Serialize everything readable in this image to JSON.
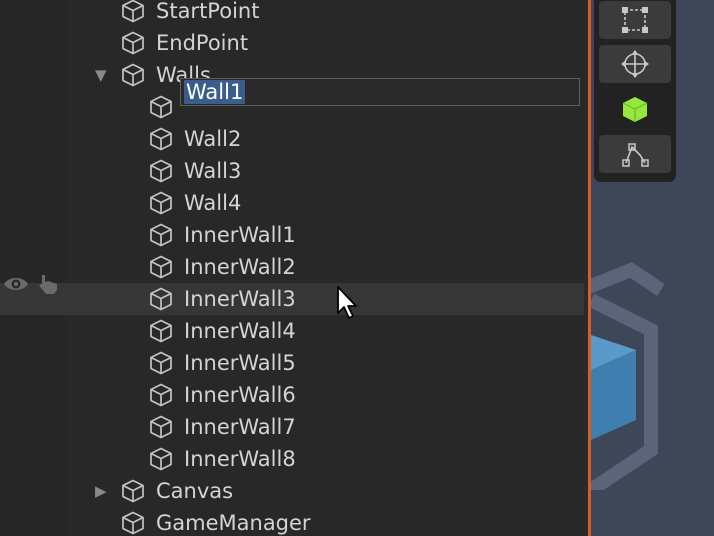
{
  "hierarchy": {
    "rows": [
      {
        "label": "StartPoint",
        "indent": 0,
        "arrow": ""
      },
      {
        "label": "EndPoint",
        "indent": 0,
        "arrow": ""
      },
      {
        "label": "Walls",
        "indent": 0,
        "arrow": "expanded"
      },
      {
        "label": "Wall1",
        "indent": 1,
        "arrow": "",
        "renaming": true
      },
      {
        "label": "Wall2",
        "indent": 1,
        "arrow": ""
      },
      {
        "label": "Wall3",
        "indent": 1,
        "arrow": ""
      },
      {
        "label": "Wall4",
        "indent": 1,
        "arrow": ""
      },
      {
        "label": "InnerWall1",
        "indent": 1,
        "arrow": ""
      },
      {
        "label": "InnerWall2",
        "indent": 1,
        "arrow": ""
      },
      {
        "label": "InnerWall3",
        "indent": 1,
        "arrow": "",
        "hovered": true
      },
      {
        "label": "InnerWall4",
        "indent": 1,
        "arrow": ""
      },
      {
        "label": "InnerWall5",
        "indent": 1,
        "arrow": ""
      },
      {
        "label": "InnerWall6",
        "indent": 1,
        "arrow": ""
      },
      {
        "label": "InnerWall7",
        "indent": 1,
        "arrow": ""
      },
      {
        "label": "InnerWall8",
        "indent": 1,
        "arrow": ""
      },
      {
        "label": "Canvas",
        "indent": 0,
        "arrow": "collapsed"
      },
      {
        "label": "GameManager",
        "indent": 0,
        "arrow": ""
      }
    ],
    "rename_value": "Wall1",
    "item_icon": "gameobject-cube-icon"
  },
  "gutter": {
    "visibility_icon": "eye-icon",
    "pickability_icon": "hand-pointer-icon"
  },
  "scene_toolbar": {
    "tools": [
      {
        "name": "rect-tool",
        "icon": "rect-transform-icon",
        "active": false
      },
      {
        "name": "transform-tool",
        "icon": "move-rotate-scale-icon",
        "active": false
      },
      {
        "name": "custom-tool",
        "icon": "green-cube-icon",
        "active": true
      },
      {
        "name": "path-tool",
        "icon": "nodes-path-icon",
        "active": false
      }
    ]
  },
  "colors": {
    "panel_bg": "#282828",
    "text": "#d4d4d4",
    "selection": "#3a5e8c",
    "accent_border": "#d65f24",
    "active_tool": "#96e83c",
    "scene_bg": "#3e4758"
  }
}
